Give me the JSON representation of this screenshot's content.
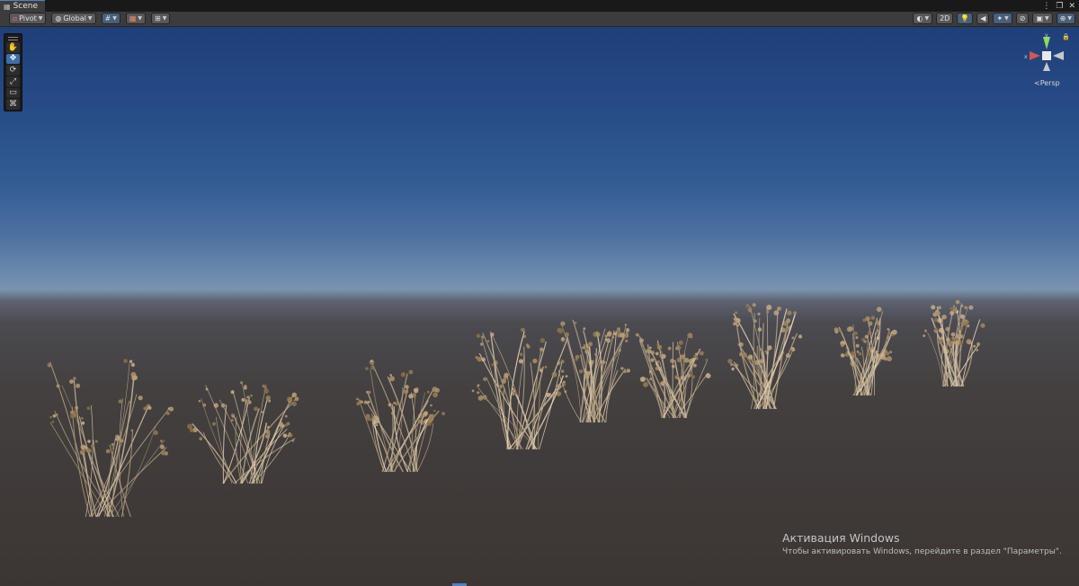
{
  "window": {
    "tab_label": "Scene",
    "tab_icon": "grid-icon",
    "controls": [
      "⋮",
      "❐",
      "✕"
    ]
  },
  "toolbar": {
    "pivot_label": "Pivot",
    "global_label": "Global",
    "two_d_label": "2D",
    "persp_label": "Persp",
    "axis_y": "y",
    "axis_x": "x"
  },
  "tools": [
    "view-tool",
    "move-tool",
    "rotate-tool",
    "scale-tool",
    "rect-tool",
    "transform-tool"
  ],
  "selected_tool": "move-tool",
  "colors": {
    "accent": "#4d84c6",
    "toolbar": "#3c3c3c",
    "sky_top": "#1f3f79",
    "ground": "#3c3533",
    "grass": "#c8b79a"
  },
  "watermark": {
    "title": "Активация Windows",
    "subtitle": "Чтобы активировать Windows, перейдите в раздел \"Параметры\"."
  }
}
